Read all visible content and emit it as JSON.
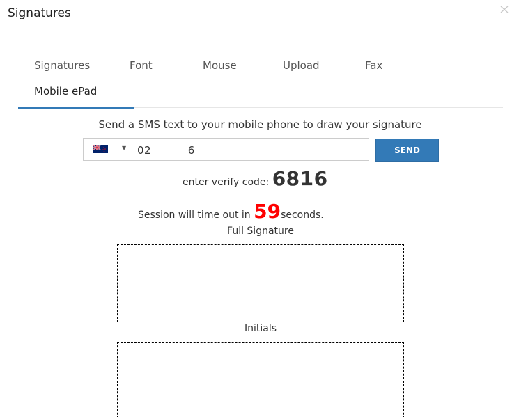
{
  "dialog": {
    "title": "Signatures"
  },
  "tabs": [
    {
      "label": "Signatures"
    },
    {
      "label": "Font"
    },
    {
      "label": "Mouse"
    },
    {
      "label": "Upload"
    },
    {
      "label": "Fax"
    },
    {
      "label": "Mobile ePad",
      "active": true
    }
  ],
  "sms": {
    "instruction": "Send a SMS text to your mobile phone to draw your signature",
    "country_flag": "new-zealand-flag-icon",
    "phone_value": "02          6",
    "send_label": "SEND"
  },
  "verify": {
    "label": "enter verify code: ",
    "code": "6816"
  },
  "timeout": {
    "prefix": "Session will time out in ",
    "seconds": "59",
    "suffix": "seconds."
  },
  "pads": {
    "full_label": "Full Signature",
    "initials_label": "Initials"
  },
  "colors": {
    "accent": "#337ab7",
    "countdown": "#ff0000"
  }
}
